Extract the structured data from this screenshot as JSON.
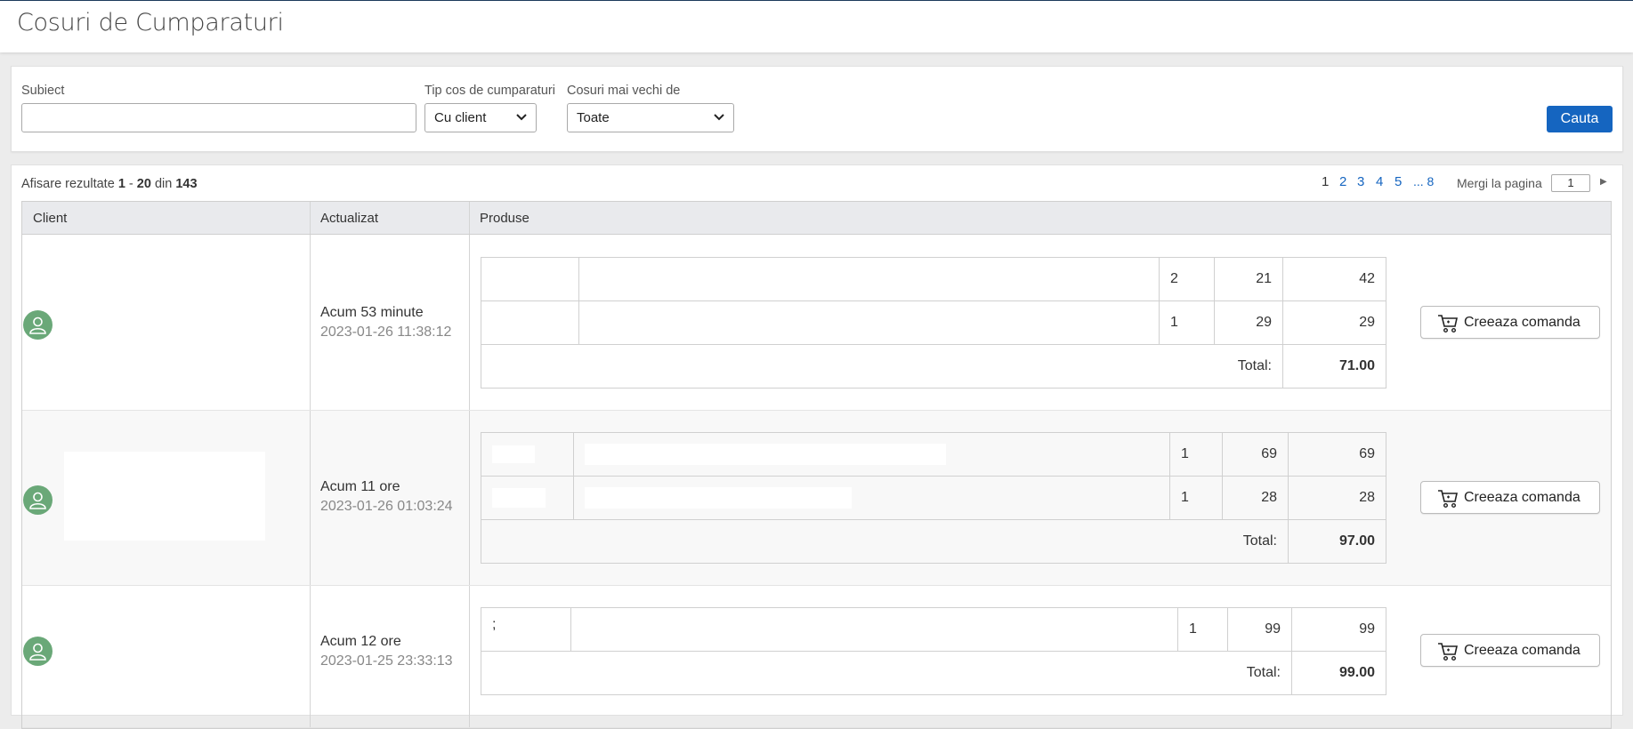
{
  "page": {
    "title": "Cosuri de Cumparaturi"
  },
  "filters": {
    "subject_label": "Subiect",
    "subject_value": "",
    "type_label": "Tip cos de cumparaturi",
    "type_value": "Cu client",
    "older_label": "Cosuri mai vechi de",
    "older_value": "Toate",
    "search_button": "Cauta"
  },
  "results": {
    "summary_prefix": "Afisare rezultate",
    "range_start": "1",
    "range_sep": "-",
    "range_end": "20",
    "of_word": "din",
    "total": "143"
  },
  "pagination": {
    "pages": [
      "1",
      "2",
      "3",
      "4",
      "5",
      "... 8"
    ],
    "current": "1",
    "goto_label": "Mergi la pagina",
    "goto_value": "1"
  },
  "table": {
    "headers": {
      "client": "Client",
      "updated": "Actualizat",
      "products": "Produse"
    },
    "total_label": "Total:",
    "order_button": "Creeaza comanda",
    "rows": [
      {
        "updated_relative": "Acum 53 minute",
        "updated_absolute": "2023-01-26 11:38:12",
        "items": [
          {
            "code": "",
            "name": "",
            "qty": "2",
            "price": "21",
            "subtotal": "42"
          },
          {
            "code": "",
            "name": "",
            "qty": "1",
            "price": "29",
            "subtotal": "29"
          }
        ],
        "total": "71.00"
      },
      {
        "updated_relative": "Acum 11 ore",
        "updated_absolute": "2023-01-26 01:03:24",
        "items": [
          {
            "code": "",
            "name": "",
            "qty": "1",
            "price": "69",
            "subtotal": "69"
          },
          {
            "code": "",
            "name": "",
            "qty": "1",
            "price": "28",
            "subtotal": "28"
          }
        ],
        "total": "97.00"
      },
      {
        "updated_relative": "Acum 12 ore",
        "updated_absolute": "2023-01-25 23:33:13",
        "items": [
          {
            "code": ";",
            "name": "",
            "qty": "1",
            "price": "99",
            "subtotal": "99"
          }
        ],
        "total": "99.00"
      }
    ]
  },
  "icons": {
    "avatar": "user-icon",
    "cart": "cart-icon",
    "select": "chevron-down-icon",
    "next": "next-page-icon"
  },
  "colors": {
    "primary": "#1565c0",
    "avatar": "#6aa878",
    "header_bg": "#e9eaed"
  }
}
